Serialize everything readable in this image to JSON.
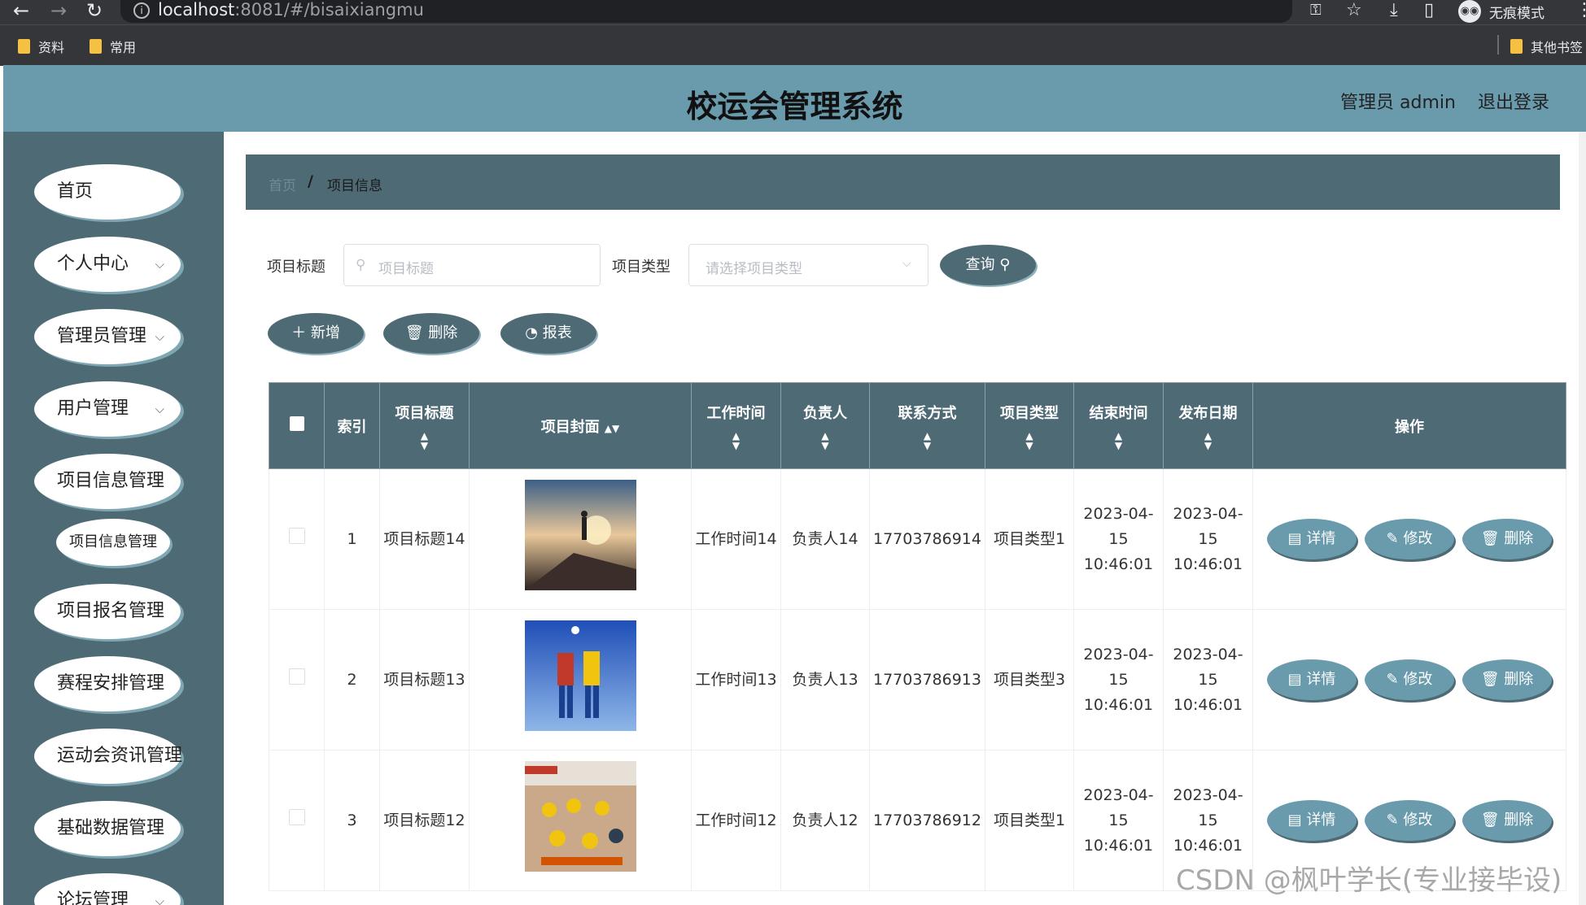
{
  "browser": {
    "url_host": "localhost",
    "url_rest": ":8081/#/bisaixiangmu",
    "incognito_label": "无痕模式",
    "bookmarks": [
      "资料",
      "常用"
    ],
    "other_bookmarks": "其他书签"
  },
  "header": {
    "title": "校运会管理系统",
    "admin": "管理员 admin",
    "logout": "退出登录"
  },
  "sidebar": {
    "items": [
      {
        "label": "首页"
      },
      {
        "label": "个人中心"
      },
      {
        "label": "管理员管理"
      },
      {
        "label": "用户管理"
      },
      {
        "label": "项目信息管理"
      },
      {
        "label": "项目信息管理"
      },
      {
        "label": "项目报名管理"
      },
      {
        "label": "赛程安排管理"
      },
      {
        "label": "运动会资讯管理"
      },
      {
        "label": "基础数据管理"
      },
      {
        "label": "论坛管理"
      }
    ]
  },
  "breadcrumb": {
    "home": "首页",
    "sep": "/",
    "current": "项目信息"
  },
  "search": {
    "title_label": "项目标题",
    "title_placeholder": "项目标题",
    "type_label": "项目类型",
    "type_placeholder": "请选择项目类型",
    "query_button": "查询"
  },
  "actions": {
    "add": "新增",
    "delete": "删除",
    "report": "报表"
  },
  "table": {
    "headers": [
      "索引",
      "项目标题",
      "项目封面",
      "工作时间",
      "负责人",
      "联系方式",
      "项目类型",
      "结束时间",
      "发布日期",
      "操作"
    ],
    "rows": [
      {
        "index": "1",
        "title": "项目标题14",
        "work_time": "工作时间14",
        "owner": "负责人14",
        "contact": "17703786914",
        "type": "项目类型1",
        "end_time": "2023-04-15 10:46:01",
        "publish_date": "2023-04-15 10:46:01"
      },
      {
        "index": "2",
        "title": "项目标题13",
        "work_time": "工作时间13",
        "owner": "负责人13",
        "contact": "17703786913",
        "type": "项目类型3",
        "end_time": "2023-04-15 10:46:01",
        "publish_date": "2023-04-15 10:46:01"
      },
      {
        "index": "3",
        "title": "项目标题12",
        "work_time": "工作时间12",
        "owner": "负责人12",
        "contact": "17703786912",
        "type": "项目类型1",
        "end_time": "2023-04-15 10:46:01",
        "publish_date": "2023-04-15 10:46:01"
      }
    ],
    "row_buttons": {
      "detail": "详情",
      "edit": "修改",
      "delete": "删除"
    }
  },
  "watermark": "CSDN @枫叶学长(专业接毕设)",
  "colors": {
    "header": "#6a9bad",
    "sidebar": "#4d6a75",
    "accent": "#4d6a75",
    "row_button": "#6a9bad"
  }
}
